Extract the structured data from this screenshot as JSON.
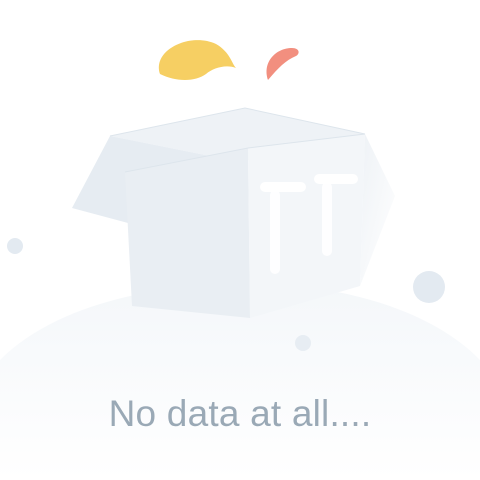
{
  "empty_state": {
    "message": "No data at all....",
    "illustration": "empty-box-illustration",
    "colors": {
      "text": "#9aa9b6",
      "box_face": "#e9eef3",
      "box_shadow": "#dfe6ec",
      "leaf_yellow": "#f6cf63",
      "leaf_red": "#f28f7f",
      "dots": "#e3eaf1"
    }
  }
}
